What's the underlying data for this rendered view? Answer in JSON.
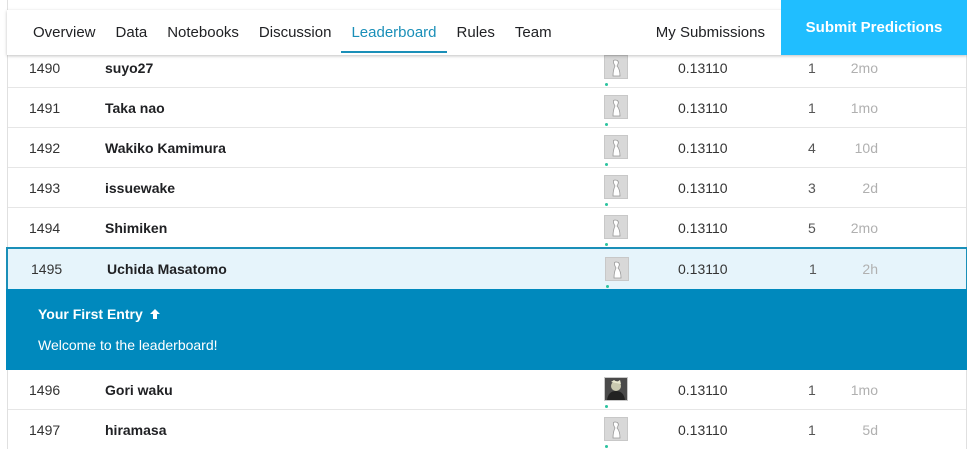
{
  "nav": {
    "tabs": [
      {
        "label": "Overview"
      },
      {
        "label": "Data"
      },
      {
        "label": "Notebooks"
      },
      {
        "label": "Discussion"
      },
      {
        "label": "Leaderboard"
      },
      {
        "label": "Rules"
      },
      {
        "label": "Team"
      }
    ],
    "active_tab": "Leaderboard",
    "my_submissions": "My Submissions",
    "submit_label": "Submit Predictions"
  },
  "leaderboard": {
    "rows_before": [
      {
        "rank": "1490",
        "team": "suyo27",
        "score": "0.13110",
        "entries": "1",
        "last": "2mo"
      },
      {
        "rank": "1491",
        "team": "Taka nao",
        "score": "0.13110",
        "entries": "1",
        "last": "1mo"
      },
      {
        "rank": "1492",
        "team": "Wakiko Kamimura",
        "score": "0.13110",
        "entries": "4",
        "last": "10d"
      },
      {
        "rank": "1493",
        "team": "issuewake",
        "score": "0.13110",
        "entries": "3",
        "last": "2d"
      },
      {
        "rank": "1494",
        "team": "Shimiken",
        "score": "0.13110",
        "entries": "5",
        "last": "2mo"
      }
    ],
    "user_row": {
      "rank": "1495",
      "team": "Uchida Masatomo",
      "score": "0.13110",
      "entries": "1",
      "last": "2h"
    },
    "rows_after": [
      {
        "rank": "1496",
        "team": "Gori waku",
        "score": "0.13110",
        "entries": "1",
        "last": "1mo"
      },
      {
        "rank": "1497",
        "team": "hiramasa",
        "score": "0.13110",
        "entries": "1",
        "last": "5d"
      }
    ]
  },
  "banner": {
    "title": "Your First Entry",
    "icon": "arrow-up-icon",
    "message": "Welcome to the leaderboard!"
  },
  "colors": {
    "accent": "#1a8fb8",
    "submit_bg": "#20beff",
    "banner_bg": "#0089bd",
    "highlight_bg": "#e6f4fb"
  }
}
